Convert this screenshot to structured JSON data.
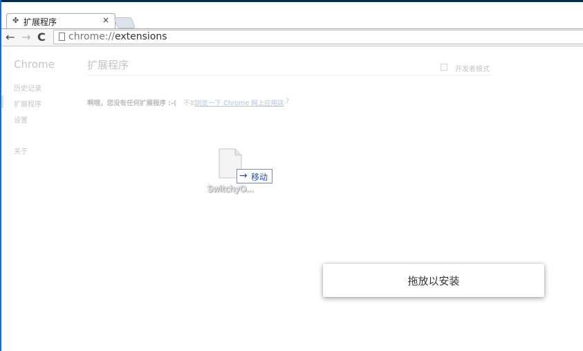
{
  "browser": {
    "tab_title": "扩展程序",
    "tab_close": "×",
    "url_scheme": "chrome://",
    "url_path": "extensions"
  },
  "sidebar": {
    "title": "Chrome",
    "items": [
      {
        "label": "历史记录"
      },
      {
        "label": "扩展程序"
      },
      {
        "label": "设置"
      },
      {
        "label": "关于"
      }
    ]
  },
  "main": {
    "title": "扩展程序",
    "developer_mode_label": "开发者模式",
    "empty_message": "啊哦，您没有任何扩展程序 :-(",
    "empty_prefix": "不如",
    "empty_link": "浏览一下 Chrome 网上应用店",
    "empty_suffix": "?"
  },
  "drag": {
    "file_name": "SwitchyO...",
    "move_label": "移动",
    "move_arrow": "→"
  },
  "overlay": {
    "drop_text": "拖放以安装"
  },
  "icons": {
    "tab_icon": "puzzle-icon",
    "back": "back-arrow-icon",
    "forward": "forward-arrow-icon",
    "reload": "reload-icon",
    "page": "page-icon",
    "file": "file-icon"
  }
}
